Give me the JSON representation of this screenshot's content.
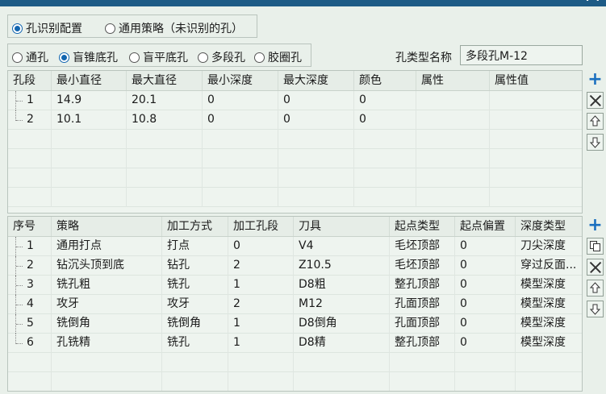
{
  "header_strip": {
    "glyph": "·  ·"
  },
  "recognition_group": {
    "options": [
      {
        "label": "孔识别配置",
        "selected": true
      },
      {
        "label": "通用策略（未识别的孔）",
        "selected": false
      }
    ]
  },
  "hole_type_group": {
    "options": [
      {
        "label": "通孔",
        "selected": false
      },
      {
        "label": "盲锥底孔",
        "selected": true
      },
      {
        "label": "盲平底孔",
        "selected": false
      },
      {
        "label": "多段孔",
        "selected": false
      },
      {
        "label": "胶圈孔",
        "selected": false
      }
    ]
  },
  "hole_type_name": {
    "label": "孔类型名称",
    "value": "多段孔M-12"
  },
  "segments_table": {
    "columns": [
      "孔段",
      "最小直径",
      "最大直径",
      "最小深度",
      "最大深度",
      "颜色",
      "属性",
      "属性值"
    ],
    "rows": [
      [
        "1",
        "14.9",
        "20.1",
        "0",
        "0",
        "0",
        "",
        ""
      ],
      [
        "2",
        "10.1",
        "10.8",
        "0",
        "0",
        "0",
        "",
        ""
      ]
    ]
  },
  "strategy_table": {
    "columns": [
      "序号",
      "策略",
      "加工方式",
      "加工孔段",
      "刀具",
      "起点类型",
      "起点偏置",
      "深度类型"
    ],
    "rows": [
      [
        "1",
        "通用打点",
        "打点",
        "0",
        "V4",
        "毛坯顶部",
        "0",
        "刀尖深度"
      ],
      [
        "2",
        "钻沉头顶到底",
        "钻孔",
        "2",
        "Z10.5",
        "毛坯顶部",
        "0",
        "穿过反面..."
      ],
      [
        "3",
        "铣孔粗",
        "铣孔",
        "1",
        "D8粗",
        "整孔顶部",
        "0",
        "模型深度"
      ],
      [
        "4",
        "攻牙",
        "攻牙",
        "2",
        "M12",
        "孔面顶部",
        "0",
        "模型深度"
      ],
      [
        "5",
        "铣倒角",
        "铣倒角",
        "1",
        "D8倒角",
        "孔面顶部",
        "0",
        "模型深度"
      ],
      [
        "6",
        "孔铣精",
        "铣孔",
        "1",
        "D8精",
        "整孔顶部",
        "0",
        "模型深度"
      ]
    ]
  },
  "icons": {
    "add": "plus-icon",
    "delete": "close-icon",
    "copy": "copy-icon",
    "move_up": "arrow-up-icon",
    "move_down": "arrow-down-icon",
    "accent": "#1366b0",
    "add_color": "#1a6fbf"
  }
}
